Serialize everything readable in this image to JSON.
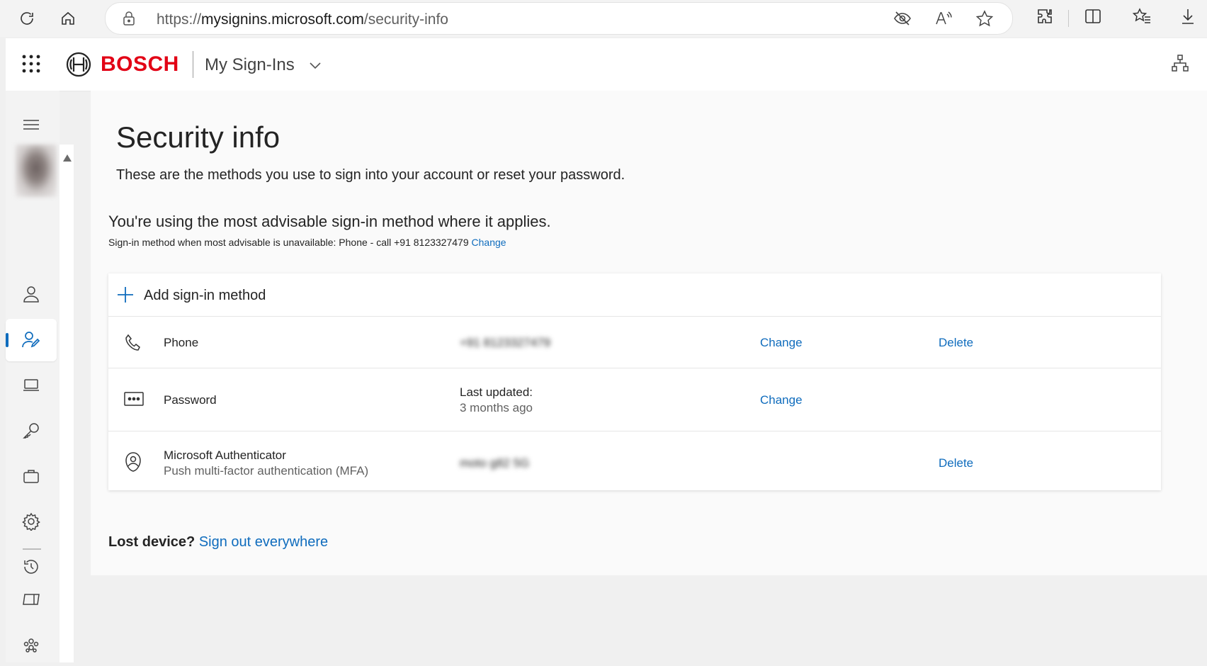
{
  "browser": {
    "url_prefix": "https://",
    "url_host": "mysignins.microsoft.com",
    "url_path": "/security-info",
    "icons": [
      "refresh-icon",
      "home-icon",
      "lock-icon",
      "tracking-prevention-icon",
      "read-aloud-icon",
      "favorite-icon",
      "extensions-icon",
      "split-screen-icon",
      "favorites-icon",
      "download-icon"
    ]
  },
  "header": {
    "brand": "BOSCH",
    "app_title": "My Sign-Ins"
  },
  "sidebar": {
    "items": [
      "menu",
      "avatar",
      "overview",
      "security-info",
      "devices",
      "password",
      "organizations",
      "settings",
      "recent-activity",
      "apps",
      "groups"
    ],
    "active": "security-info"
  },
  "main": {
    "title": "Security info",
    "description": "These are the methods you use to sign into your account or reset your password.",
    "advisable": "You're using the most advisable sign-in method where it applies.",
    "fallback_text": "Sign-in method when most advisable is unavailable: Phone - call +91 8123327479",
    "fallback_change": "Change",
    "add_method": "Add sign-in method",
    "methods": [
      {
        "name": "Phone",
        "detail": "+91 8123327479",
        "change": "Change",
        "delete": "Delete"
      },
      {
        "name": "Password",
        "detail": "Last updated:",
        "detail_sub": "3 months ago",
        "change": "Change"
      },
      {
        "name": "Microsoft Authenticator",
        "sub": "Push multi-factor authentication (MFA)",
        "detail": "moto g82 5G",
        "delete": "Delete"
      }
    ],
    "lost_device": "Lost device?",
    "sign_out": "Sign out everywhere"
  },
  "colors": {
    "accent": "#0f6cbd",
    "brand_red": "#e20015"
  }
}
